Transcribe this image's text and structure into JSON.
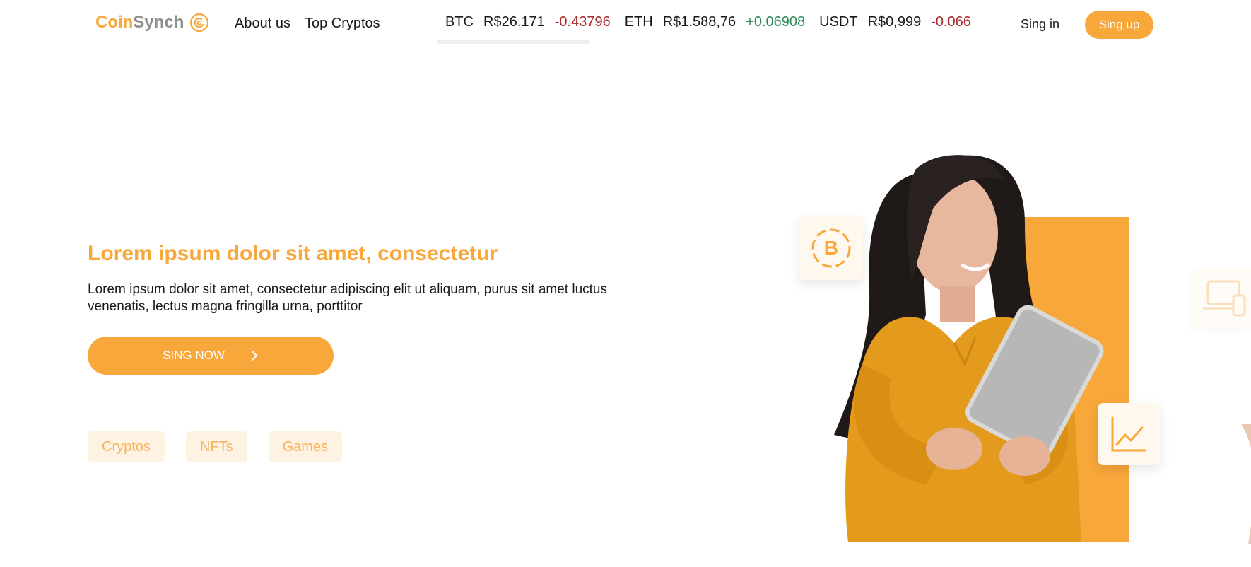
{
  "header": {
    "logo": {
      "part1": "Coin",
      "part2": "Synch"
    },
    "nav": [
      {
        "label": "About us"
      },
      {
        "label": "Top Cryptos"
      }
    ],
    "ticker": [
      {
        "symbol": "BTC",
        "price": "R$26.171",
        "change": "-0.43796",
        "trend": "down"
      },
      {
        "symbol": "ETH",
        "price": "R$1.588,76",
        "change": "+0.06908",
        "trend": "up"
      },
      {
        "symbol": "USDT",
        "price": "R$0,999",
        "change": "-0.066",
        "trend": "down"
      }
    ],
    "signin_label": "Sing in",
    "signup_label": "Sing up"
  },
  "hero": {
    "title": "Lorem ipsum dolor sit amet, consectetur",
    "text": "Lorem ipsum dolor sit amet, consectetur adipiscing elit ut aliquam, purus sit amet luctus venenatis, lectus magna fringilla urna, porttitor",
    "cta_label": "SING NOW",
    "tags": [
      {
        "label": "Cryptos"
      },
      {
        "label": "NFTs"
      },
      {
        "label": "Games"
      }
    ]
  },
  "colors": {
    "accent": "#f8a73a",
    "accent_light": "#fef3e3",
    "negative": "#a52a2a",
    "positive": "#2e8b57"
  },
  "icons": {
    "logo": "coin-swirl-icon",
    "btc_card": "bitcoin-icon",
    "chart_card": "line-chart-icon",
    "devices_card": "devices-icon",
    "cta_arrow": "chevron-right-icon"
  }
}
